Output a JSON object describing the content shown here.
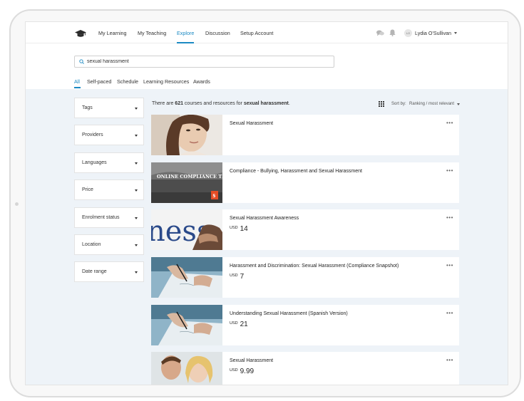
{
  "nav": {
    "items": [
      {
        "label": "My Learning"
      },
      {
        "label": "My Teaching"
      },
      {
        "label": "Explore"
      },
      {
        "label": "Discussion"
      },
      {
        "label": "Setup Account"
      }
    ],
    "active": "Explore",
    "user": {
      "initials": "LO",
      "name": "Lydia O'Sullivan"
    }
  },
  "search": {
    "value": "sexual harassment"
  },
  "tabs": [
    {
      "label": "All"
    },
    {
      "label": "Self-paced"
    },
    {
      "label": "Schedule"
    },
    {
      "label": "Learning Resources"
    },
    {
      "label": "Awards"
    }
  ],
  "facets": [
    {
      "label": "Tags"
    },
    {
      "label": "Providers"
    },
    {
      "label": "Languages"
    },
    {
      "label": "Price"
    },
    {
      "label": "Enrolment status"
    },
    {
      "label": "Location"
    },
    {
      "label": "Date range"
    }
  ],
  "results": {
    "prefix": "There are ",
    "count": "621",
    "middle": " courses and resources for ",
    "query": "sexual harassment",
    "suffix": ".",
    "sort_label": "Sort by:",
    "sort_value": "Ranking / most relevant"
  },
  "courses": [
    {
      "title": "Sexual Harassment",
      "currency": "",
      "price": "",
      "thumb": "woman-portrait"
    },
    {
      "title": "Compliance - Bullying, Harassment and Sexual Harassment",
      "currency": "",
      "price": "",
      "thumb": "online-compliance",
      "thumb_text": "ONLINE COMPLIANCE TRAINING"
    },
    {
      "title": "Sexual Harassment Awareness",
      "currency": "USD",
      "price": "14",
      "thumb": "newspaper",
      "thumb_text": "ness"
    },
    {
      "title": "Harassment and Discrimination: Sexual Harassment (Compliance Snapshot)",
      "currency": "USD",
      "price": "7",
      "thumb": "signing"
    },
    {
      "title": "Understanding Sexual Harassment (Spanish Version)",
      "currency": "USD",
      "price": "21",
      "thumb": "signing"
    },
    {
      "title": "Sexual Harassment",
      "currency": "USD",
      "price": "9.99",
      "thumb": "couple"
    }
  ],
  "colors": {
    "accent": "#1c8ac3",
    "content_bg": "#eef3f8"
  }
}
